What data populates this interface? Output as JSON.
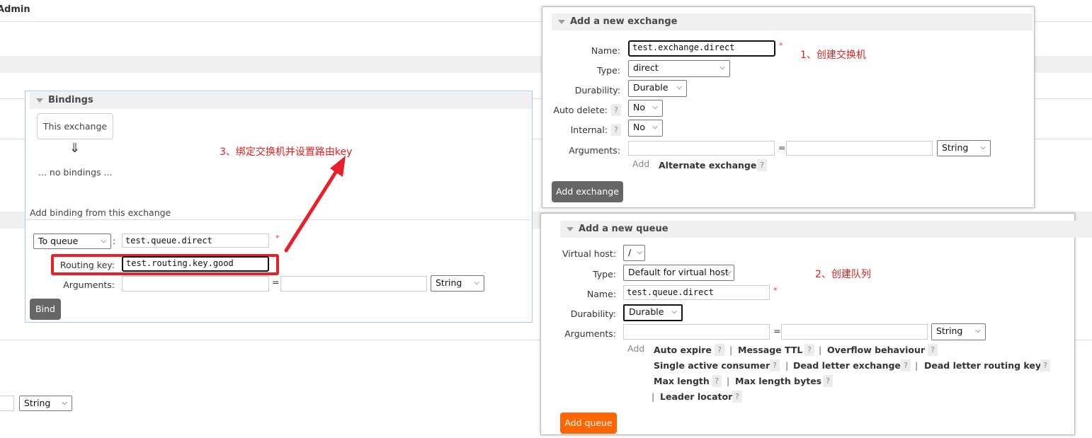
{
  "background": {
    "admin_text": "Admin",
    "arguments_type": "String"
  },
  "exchange_panel": {
    "title": "Add a new exchange",
    "name_label": "Name:",
    "name_value": "test.exchange.direct",
    "type_label": "Type:",
    "type_value": "direct",
    "durability_label": "Durability:",
    "durability_value": "Durable",
    "auto_delete_label": "Auto delete:",
    "auto_delete_value": "No",
    "internal_label": "Internal:",
    "internal_value": "No",
    "arguments_label": "Arguments:",
    "arguments_type": "String",
    "add_link": "Add",
    "alternate_exchange": "Alternate exchange",
    "help": "?",
    "equals": "=",
    "required": "*",
    "submit": "Add exchange"
  },
  "queue_panel": {
    "title": "Add a new queue",
    "vhost_label": "Virtual host:",
    "vhost_value": "/",
    "type_label": "Type:",
    "type_value": "Default for virtual host",
    "name_label": "Name:",
    "name_value": "test.queue.direct",
    "durability_label": "Durability:",
    "durability_value": "Durable",
    "arguments_label": "Arguments:",
    "arguments_type": "String",
    "add_link": "Add",
    "help": "?",
    "pipe": "|",
    "equals": "=",
    "required": "*",
    "options": {
      "auto_expire": "Auto expire",
      "message_ttl": "Message TTL",
      "overflow_behaviour": "Overflow behaviour",
      "single_active_consumer": "Single active consumer",
      "dead_letter_exchange": "Dead letter exchange",
      "dead_letter_routing_key": "Dead letter routing key",
      "max_length": "Max length",
      "max_length_bytes": "Max length bytes",
      "leader_locator": "Leader locator"
    },
    "submit": "Add queue"
  },
  "bindings_panel": {
    "title": "Bindings",
    "this_exchange": "This exchange",
    "arrow": "⇓",
    "no_bindings": "... no bindings ...",
    "add_binding_title": "Add binding from this exchange",
    "destination_type": "To queue",
    "colon": ":",
    "destination_value": "test.queue.direct",
    "required": "*",
    "routing_key_label": "Routing key:",
    "routing_key_value": "test.routing.key.good",
    "arguments_label": "Arguments:",
    "equals": "=",
    "arguments_type": "String",
    "submit": "Bind"
  },
  "annotations": {
    "step1": "1、创建交换机",
    "step2": "2、创建队列",
    "step3": "3、绑定交换机并设置路由key",
    "color": "#e02020"
  }
}
